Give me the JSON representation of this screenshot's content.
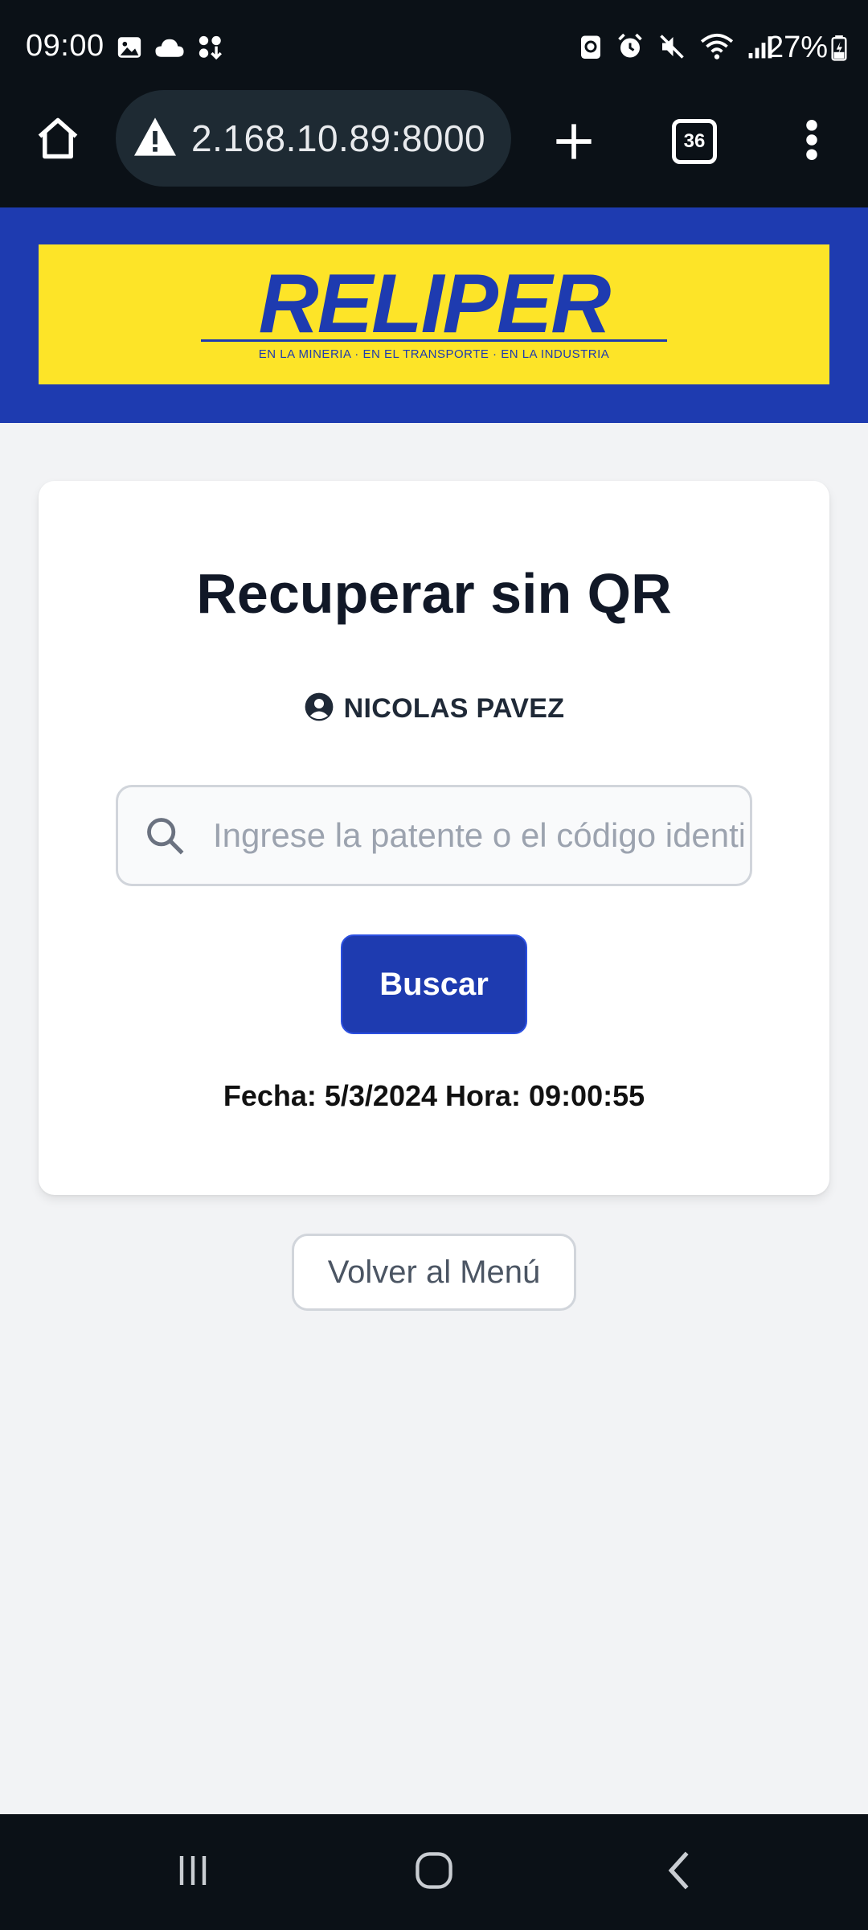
{
  "status_bar": {
    "time": "09:00",
    "battery": "27%"
  },
  "browser": {
    "url": "2.168.10.89:8000",
    "tab_count": "36"
  },
  "header": {
    "logo_text": "RELIPER",
    "logo_tagline": "EN LA MINERIA · EN EL TRANSPORTE · EN LA INDUSTRIA",
    "background_color": "#1e3bb0",
    "logo_background_color": "#fde428"
  },
  "card": {
    "title": "Recuperar sin QR",
    "user_name": "NICOLAS PAVEZ",
    "search": {
      "value": "",
      "placeholder": "Ingrese la patente o el código identificador"
    },
    "search_button_label": "Buscar",
    "datetime": "Fecha: 5/3/2024 Hora: 09:00:55"
  },
  "back_button_label": "Volver al Menú",
  "icons": {
    "status_left": [
      "gallery-icon",
      "cloud-icon",
      "download-icon"
    ],
    "status_right": [
      "data-saver-icon",
      "alarm-icon",
      "mute-icon",
      "wifi-icon",
      "signal-icon",
      "battery-icon"
    ],
    "toolbar": [
      "home-icon",
      "warning-icon",
      "plus-icon",
      "tabs-icon",
      "more-vert-icon"
    ],
    "nav": [
      "recent-apps-icon",
      "home-circle-icon",
      "back-icon"
    ]
  }
}
